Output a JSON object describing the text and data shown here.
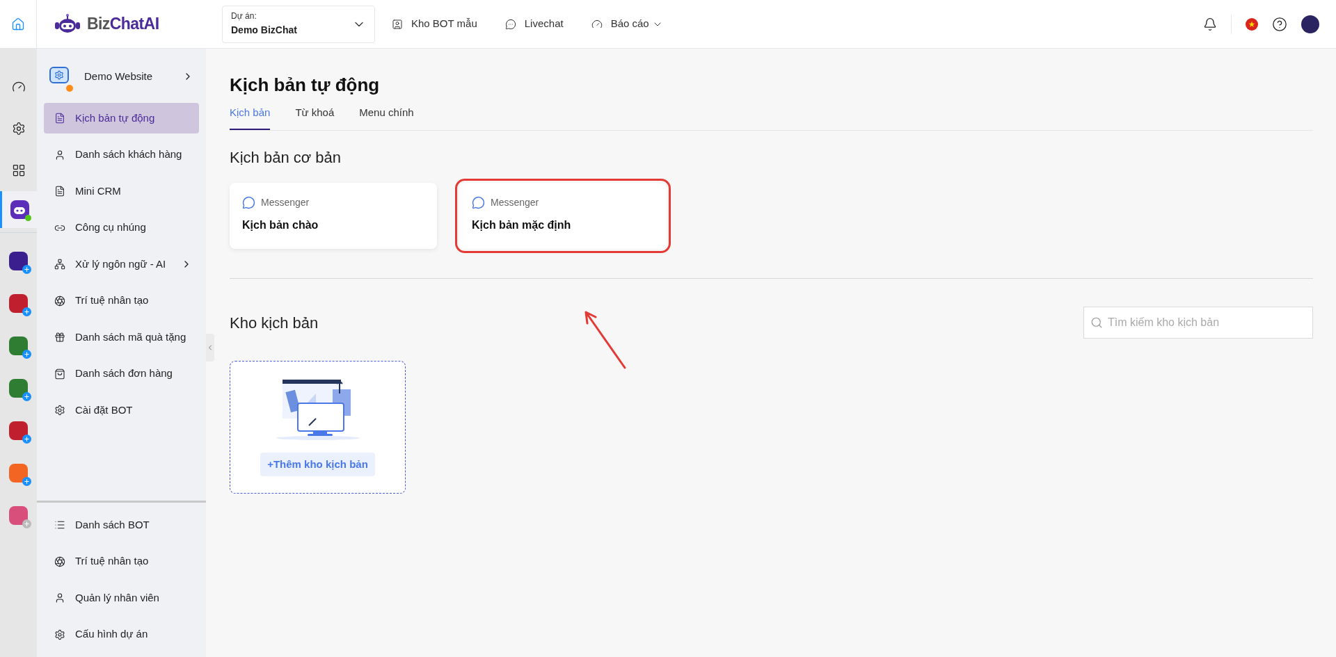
{
  "brand": {
    "prefix": "Biz",
    "suffix": "ChatAI"
  },
  "project": {
    "label": "Dự án:",
    "value": "Demo BizChat"
  },
  "nav": [
    {
      "label": "Kho BOT mẫu",
      "dropdown": false
    },
    {
      "label": "Livechat",
      "dropdown": false
    },
    {
      "label": "Báo cáo",
      "dropdown": true
    }
  ],
  "rail": {
    "apps": [
      {
        "color": "#3b1f8f",
        "added": true
      },
      {
        "color": "#c0202e",
        "added": true
      },
      {
        "color": "#2e7d32",
        "added": true
      },
      {
        "color": "#2e7d32",
        "added": true
      },
      {
        "color": "#c0202e",
        "added": true
      },
      {
        "color": "#f26522",
        "added": true
      },
      {
        "color": "#d94f7c",
        "added": false
      }
    ]
  },
  "sidebar": {
    "bot": {
      "name": "Demo Website"
    },
    "items": [
      {
        "label": "Kịch bản tự động",
        "selected": true,
        "expandable": false
      },
      {
        "label": "Danh sách khách hàng",
        "selected": false,
        "expandable": false
      },
      {
        "label": "Mini CRM",
        "selected": false,
        "expandable": false
      },
      {
        "label": "Công cụ nhúng",
        "selected": false,
        "expandable": false
      },
      {
        "label": "Xử lý ngôn ngữ - AI",
        "selected": false,
        "expandable": true
      },
      {
        "label": "Trí tuệ nhân tạo",
        "selected": false,
        "expandable": false
      },
      {
        "label": "Danh sách mã quà tặng",
        "selected": false,
        "expandable": false
      },
      {
        "label": "Danh sách đơn hàng",
        "selected": false,
        "expandable": false
      },
      {
        "label": "Cài đặt BOT",
        "selected": false,
        "expandable": false
      }
    ],
    "footer_items": [
      {
        "label": "Danh sách BOT"
      },
      {
        "label": "Trí tuệ nhân tạo"
      },
      {
        "label": "Quản lý nhân viên"
      },
      {
        "label": "Cấu hình dự án"
      }
    ]
  },
  "page": {
    "title": "Kịch bản tự động",
    "tabs": [
      {
        "label": "Kịch bản",
        "selected": true
      },
      {
        "label": "Từ khoá",
        "selected": false
      },
      {
        "label": "Menu chính",
        "selected": false
      }
    ],
    "basic_section": {
      "title": "Kịch bản cơ bản",
      "cards": [
        {
          "channel": "Messenger",
          "name": "Kịch bản chào",
          "highlighted": false
        },
        {
          "channel": "Messenger",
          "name": "Kịch bản mặc định",
          "highlighted": true
        }
      ]
    },
    "library_section": {
      "title": "Kho kịch bản",
      "search": {
        "placeholder": "Tìm kiếm kho kịch bản"
      },
      "add_button": "+Thêm kho kịch bản"
    }
  }
}
